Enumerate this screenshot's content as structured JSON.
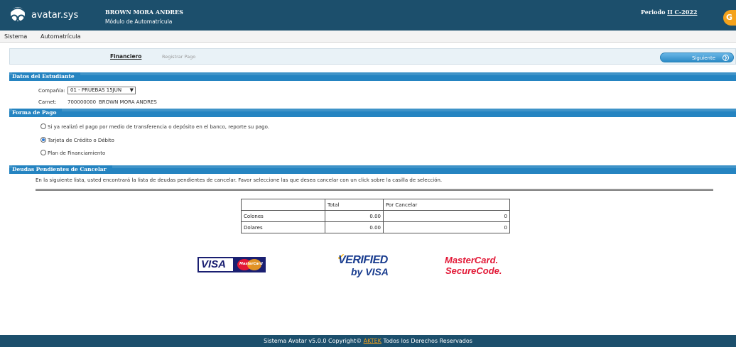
{
  "header": {
    "logo_text": "avatar.sys",
    "user_name": "BROWN MORA ANDRES",
    "module": "Módulo de Automatrícula",
    "periodo_label": "Periodo",
    "periodo_value": "II C-2022",
    "exit_icon": "exit-icon"
  },
  "menu": {
    "items": [
      "Sistema",
      "Automatrícula"
    ]
  },
  "tabs": {
    "active": "Financiero",
    "inactive": "Registrar Pago",
    "next_label": "Siguiente"
  },
  "student": {
    "section_title": "Datos del Estudiante",
    "company_label": "Compañía:",
    "company_value": "01 - PRUEBAS 15JUN",
    "carnet_label": "Carnet:",
    "carnet_value": "700000000",
    "carnet_name": "BROWN MORA ANDRES"
  },
  "payment": {
    "section_title": "Forma de Pago",
    "options": [
      {
        "label": "Si ya realizó el pago por medio de transferencia o depósito en el banco, reporte su pago.",
        "checked": false
      },
      {
        "label": "Tarjeta de Crédito o Débito",
        "checked": true
      },
      {
        "label": "Plan de Financiamiento",
        "checked": false
      }
    ]
  },
  "debts": {
    "section_title": "Deudas Pendientes de Cancelar",
    "info": "En la siguiente lista, usted encontrará la lista de deudas pendientes de cancelar. Favor seleccione las que desea cancelar con un click sobre la casilla de selección.",
    "columns": [
      "",
      "Total",
      "Por Cancelar"
    ],
    "rows": [
      [
        "Colones",
        "0.00",
        "0"
      ],
      [
        "Dolares",
        "0.00",
        "0"
      ]
    ]
  },
  "cards": {
    "visa": "VISA",
    "visa_mc_mini": "MasterCard",
    "vbv_line1": "VERIFIED",
    "vbv_line2": "by VISA",
    "mcsc_line1": "MasterCard.",
    "mcsc_line2": "SecureCode."
  },
  "footer": {
    "prefix": "Sistema Avatar v5.0.0 Copyright© ",
    "link": "AKTEK",
    "suffix": " Todos los Derechos Reservados"
  },
  "colors": {
    "header_bg": "#1c4f6c",
    "section_bg": "#2584c1",
    "accent_orange": "#f4a21b"
  }
}
